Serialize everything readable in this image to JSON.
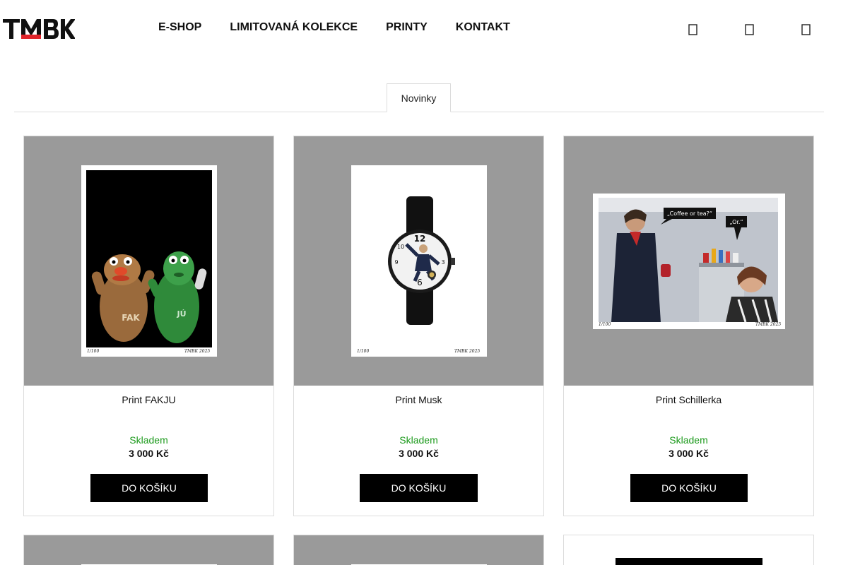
{
  "header": {
    "logo_text": "TMBK",
    "nav": [
      "E-SHOP",
      "LIMITOVANÁ KOLEKCE",
      "PRINTY",
      "KONTAKT"
    ],
    "icons": [
      "search-icon",
      "user-icon",
      "cart-icon"
    ]
  },
  "tabs": {
    "active": "Novinky"
  },
  "products": [
    {
      "name": "Print FAKJU",
      "stock": "Skladem",
      "price": "3 000 Kč",
      "button": "DO KOŠÍKU",
      "edition": "1/100",
      "signature": "TMBK 2025",
      "art_labels": [
        "FAK",
        "JÚ"
      ]
    },
    {
      "name": "Print Musk",
      "stock": "Skladem",
      "price": "3 000 Kč",
      "button": "DO KOŠÍKU",
      "edition": "1/100",
      "signature": "TMBK 2025",
      "art_labels": [
        "12",
        "3",
        "6",
        "9",
        "10"
      ]
    },
    {
      "name": "Print Schillerka",
      "stock": "Skladem",
      "price": "3 000 Kč",
      "button": "DO KOŠÍKU",
      "edition": "1/100",
      "signature": "TMBK 2025",
      "art_labels": [
        "„Coffee or tea?“",
        "„Or.“"
      ]
    }
  ],
  "colors": {
    "stock": "#1c9a1c",
    "logo_accent": "#e0242a",
    "card_image_bg": "#9a9a9a"
  }
}
